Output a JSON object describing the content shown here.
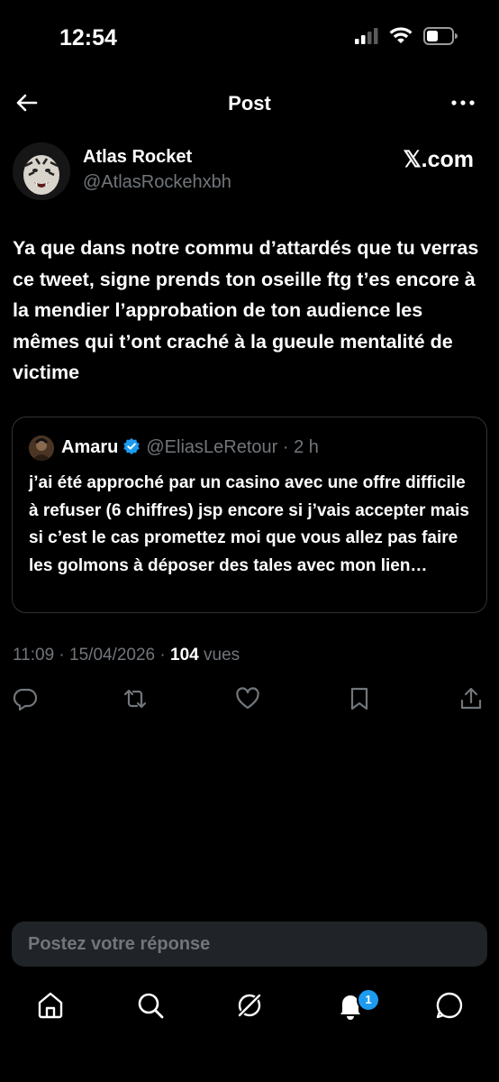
{
  "status_bar": {
    "time": "12:54"
  },
  "header": {
    "title": "Post"
  },
  "author": {
    "name": "Atlas Rocket",
    "handle": "@AtlasRockehxbh",
    "source": "𝕏.com"
  },
  "tweet": {
    "text": "Ya que dans notre commu d’attardés que tu verras ce tweet, signe prends ton oseille ftg t’es encore à la mendier l’approbation de ton audience les mêmes qui t’ont craché à la gueule mentalité de victime"
  },
  "quote": {
    "name": "Amaru",
    "handle": "@EliasLeRetour",
    "separator": " · ",
    "time": "2 h",
    "text": "j’ai été approché par un casino avec une offre difficile à refuser (6 chiffres) jsp encore si j’vais accepter mais si c’est le cas promettez moi que vous allez pas faire les golmons à déposer des tales avec mon lien…"
  },
  "meta": {
    "time": "11:09",
    "date": "15/04/2026",
    "views_count": "104",
    "views_label": "vues"
  },
  "reply": {
    "placeholder": "Postez votre réponse"
  },
  "notifications": {
    "badge": "1"
  },
  "colors": {
    "accent": "#1d9bf0",
    "background": "#000000",
    "muted": "#71767b"
  }
}
